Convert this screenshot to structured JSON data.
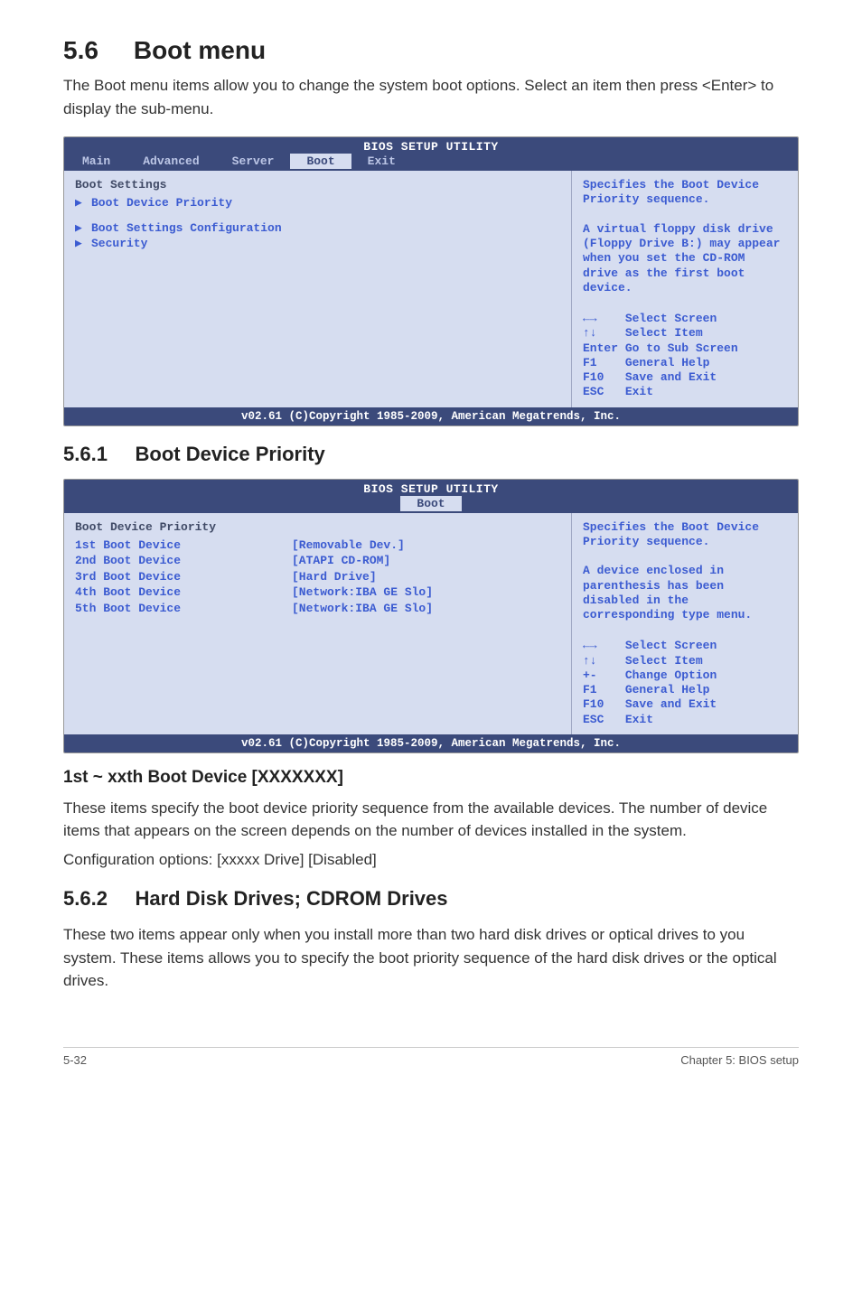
{
  "section": {
    "number": "5.6",
    "title": "Boot menu",
    "intro": "The Boot menu items allow you to change the system boot options. Select an item then press <Enter> to display the sub-menu."
  },
  "bios1": {
    "title": "BIOS SETUP UTILITY",
    "tabs": [
      "Main",
      "Advanced",
      "Server",
      "Boot",
      "Exit"
    ],
    "active_tab": "Boot",
    "heading": "Boot Settings",
    "items": [
      "Boot Device Priority",
      "",
      "Boot Settings Configuration",
      "Security"
    ],
    "help_top": "Specifies the Boot Device Priority sequence.\n\nA virtual floppy disk drive (Floppy Drive B:) may appear when you set the CD-ROM drive as the first boot device.",
    "nav": [
      [
        "←→",
        "Select Screen"
      ],
      [
        "↑↓",
        "Select Item"
      ],
      [
        "Enter",
        "Go to Sub Screen"
      ],
      [
        "F1",
        "General Help"
      ],
      [
        "F10",
        "Save and Exit"
      ],
      [
        "ESC",
        "Exit"
      ]
    ],
    "footer": "v02.61 (C)Copyright 1985-2009, American Megatrends, Inc."
  },
  "sub1": {
    "number": "5.6.1",
    "title": "Boot Device Priority"
  },
  "bios2": {
    "title": "BIOS SETUP UTILITY",
    "active_tab": "Boot",
    "heading": "Boot Device Priority",
    "rows": [
      {
        "k": "1st Boot Device",
        "v": "[Removable Dev.]"
      },
      {
        "k": "2nd Boot Device",
        "v": "[ATAPI CD-ROM]"
      },
      {
        "k": "3rd Boot Device",
        "v": "[Hard Drive]"
      },
      {
        "k": "4th Boot Device",
        "v": "[Network:IBA GE Slo]"
      },
      {
        "k": "5th Boot Device",
        "v": "[Network:IBA GE Slo]"
      }
    ],
    "help_top": "Specifies the Boot Device Priority sequence.\n\nA device enclosed in parenthesis has been disabled in the corresponding type menu.",
    "nav": [
      [
        "←→",
        "Select Screen"
      ],
      [
        "↑↓",
        "Select Item"
      ],
      [
        "+-",
        "Change Option"
      ],
      [
        "F1",
        "General Help"
      ],
      [
        "F10",
        "Save and Exit"
      ],
      [
        "ESC",
        "Exit"
      ]
    ],
    "footer": "v02.61 (C)Copyright 1985-2009, American Megatrends, Inc."
  },
  "boot_device_section": {
    "heading": "1st ~ xxth Boot Device [XXXXXXX]",
    "p1": "These items specify the boot device priority sequence from the available devices. The number of device items that appears on the screen depends on the number of devices installed in the system.",
    "p2": "Configuration options: [xxxxx Drive] [Disabled]"
  },
  "sub2": {
    "number": "5.6.2",
    "title": "Hard Disk Drives; CDROM Drives",
    "p": "These two items appear only when you install more than two hard disk drives or optical drives to you system. These items allows you to specify the boot priority sequence of the hard disk drives or the optical drives."
  },
  "page_footer": {
    "left": "5-32",
    "right": "Chapter 5: BIOS setup"
  }
}
